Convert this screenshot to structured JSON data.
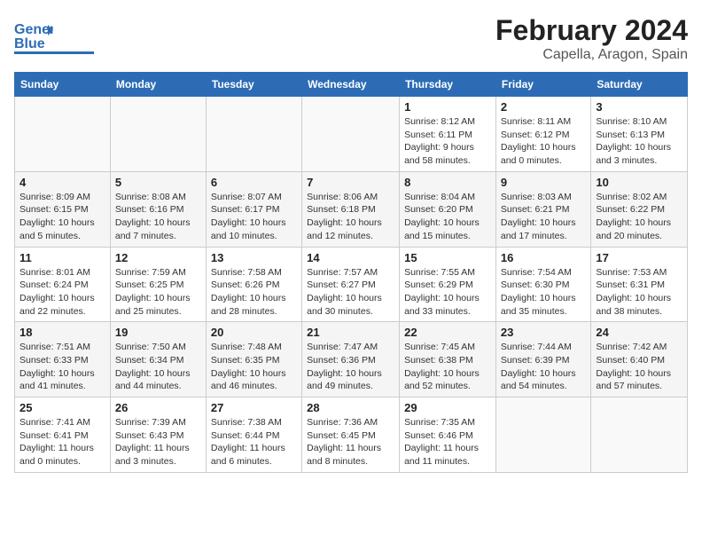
{
  "header": {
    "logo_line1": "General",
    "logo_line2": "Blue",
    "title": "February 2024",
    "subtitle": "Capella, Aragon, Spain"
  },
  "days_of_week": [
    "Sunday",
    "Monday",
    "Tuesday",
    "Wednesday",
    "Thursday",
    "Friday",
    "Saturday"
  ],
  "weeks": [
    [
      {
        "day": "",
        "info": ""
      },
      {
        "day": "",
        "info": ""
      },
      {
        "day": "",
        "info": ""
      },
      {
        "day": "",
        "info": ""
      },
      {
        "day": "1",
        "info": "Sunrise: 8:12 AM\nSunset: 6:11 PM\nDaylight: 9 hours and 58 minutes."
      },
      {
        "day": "2",
        "info": "Sunrise: 8:11 AM\nSunset: 6:12 PM\nDaylight: 10 hours and 0 minutes."
      },
      {
        "day": "3",
        "info": "Sunrise: 8:10 AM\nSunset: 6:13 PM\nDaylight: 10 hours and 3 minutes."
      }
    ],
    [
      {
        "day": "4",
        "info": "Sunrise: 8:09 AM\nSunset: 6:15 PM\nDaylight: 10 hours and 5 minutes."
      },
      {
        "day": "5",
        "info": "Sunrise: 8:08 AM\nSunset: 6:16 PM\nDaylight: 10 hours and 7 minutes."
      },
      {
        "day": "6",
        "info": "Sunrise: 8:07 AM\nSunset: 6:17 PM\nDaylight: 10 hours and 10 minutes."
      },
      {
        "day": "7",
        "info": "Sunrise: 8:06 AM\nSunset: 6:18 PM\nDaylight: 10 hours and 12 minutes."
      },
      {
        "day": "8",
        "info": "Sunrise: 8:04 AM\nSunset: 6:20 PM\nDaylight: 10 hours and 15 minutes."
      },
      {
        "day": "9",
        "info": "Sunrise: 8:03 AM\nSunset: 6:21 PM\nDaylight: 10 hours and 17 minutes."
      },
      {
        "day": "10",
        "info": "Sunrise: 8:02 AM\nSunset: 6:22 PM\nDaylight: 10 hours and 20 minutes."
      }
    ],
    [
      {
        "day": "11",
        "info": "Sunrise: 8:01 AM\nSunset: 6:24 PM\nDaylight: 10 hours and 22 minutes."
      },
      {
        "day": "12",
        "info": "Sunrise: 7:59 AM\nSunset: 6:25 PM\nDaylight: 10 hours and 25 minutes."
      },
      {
        "day": "13",
        "info": "Sunrise: 7:58 AM\nSunset: 6:26 PM\nDaylight: 10 hours and 28 minutes."
      },
      {
        "day": "14",
        "info": "Sunrise: 7:57 AM\nSunset: 6:27 PM\nDaylight: 10 hours and 30 minutes."
      },
      {
        "day": "15",
        "info": "Sunrise: 7:55 AM\nSunset: 6:29 PM\nDaylight: 10 hours and 33 minutes."
      },
      {
        "day": "16",
        "info": "Sunrise: 7:54 AM\nSunset: 6:30 PM\nDaylight: 10 hours and 35 minutes."
      },
      {
        "day": "17",
        "info": "Sunrise: 7:53 AM\nSunset: 6:31 PM\nDaylight: 10 hours and 38 minutes."
      }
    ],
    [
      {
        "day": "18",
        "info": "Sunrise: 7:51 AM\nSunset: 6:33 PM\nDaylight: 10 hours and 41 minutes."
      },
      {
        "day": "19",
        "info": "Sunrise: 7:50 AM\nSunset: 6:34 PM\nDaylight: 10 hours and 44 minutes."
      },
      {
        "day": "20",
        "info": "Sunrise: 7:48 AM\nSunset: 6:35 PM\nDaylight: 10 hours and 46 minutes."
      },
      {
        "day": "21",
        "info": "Sunrise: 7:47 AM\nSunset: 6:36 PM\nDaylight: 10 hours and 49 minutes."
      },
      {
        "day": "22",
        "info": "Sunrise: 7:45 AM\nSunset: 6:38 PM\nDaylight: 10 hours and 52 minutes."
      },
      {
        "day": "23",
        "info": "Sunrise: 7:44 AM\nSunset: 6:39 PM\nDaylight: 10 hours and 54 minutes."
      },
      {
        "day": "24",
        "info": "Sunrise: 7:42 AM\nSunset: 6:40 PM\nDaylight: 10 hours and 57 minutes."
      }
    ],
    [
      {
        "day": "25",
        "info": "Sunrise: 7:41 AM\nSunset: 6:41 PM\nDaylight: 11 hours and 0 minutes."
      },
      {
        "day": "26",
        "info": "Sunrise: 7:39 AM\nSunset: 6:43 PM\nDaylight: 11 hours and 3 minutes."
      },
      {
        "day": "27",
        "info": "Sunrise: 7:38 AM\nSunset: 6:44 PM\nDaylight: 11 hours and 6 minutes."
      },
      {
        "day": "28",
        "info": "Sunrise: 7:36 AM\nSunset: 6:45 PM\nDaylight: 11 hours and 8 minutes."
      },
      {
        "day": "29",
        "info": "Sunrise: 7:35 AM\nSunset: 6:46 PM\nDaylight: 11 hours and 11 minutes."
      },
      {
        "day": "",
        "info": ""
      },
      {
        "day": "",
        "info": ""
      }
    ]
  ]
}
